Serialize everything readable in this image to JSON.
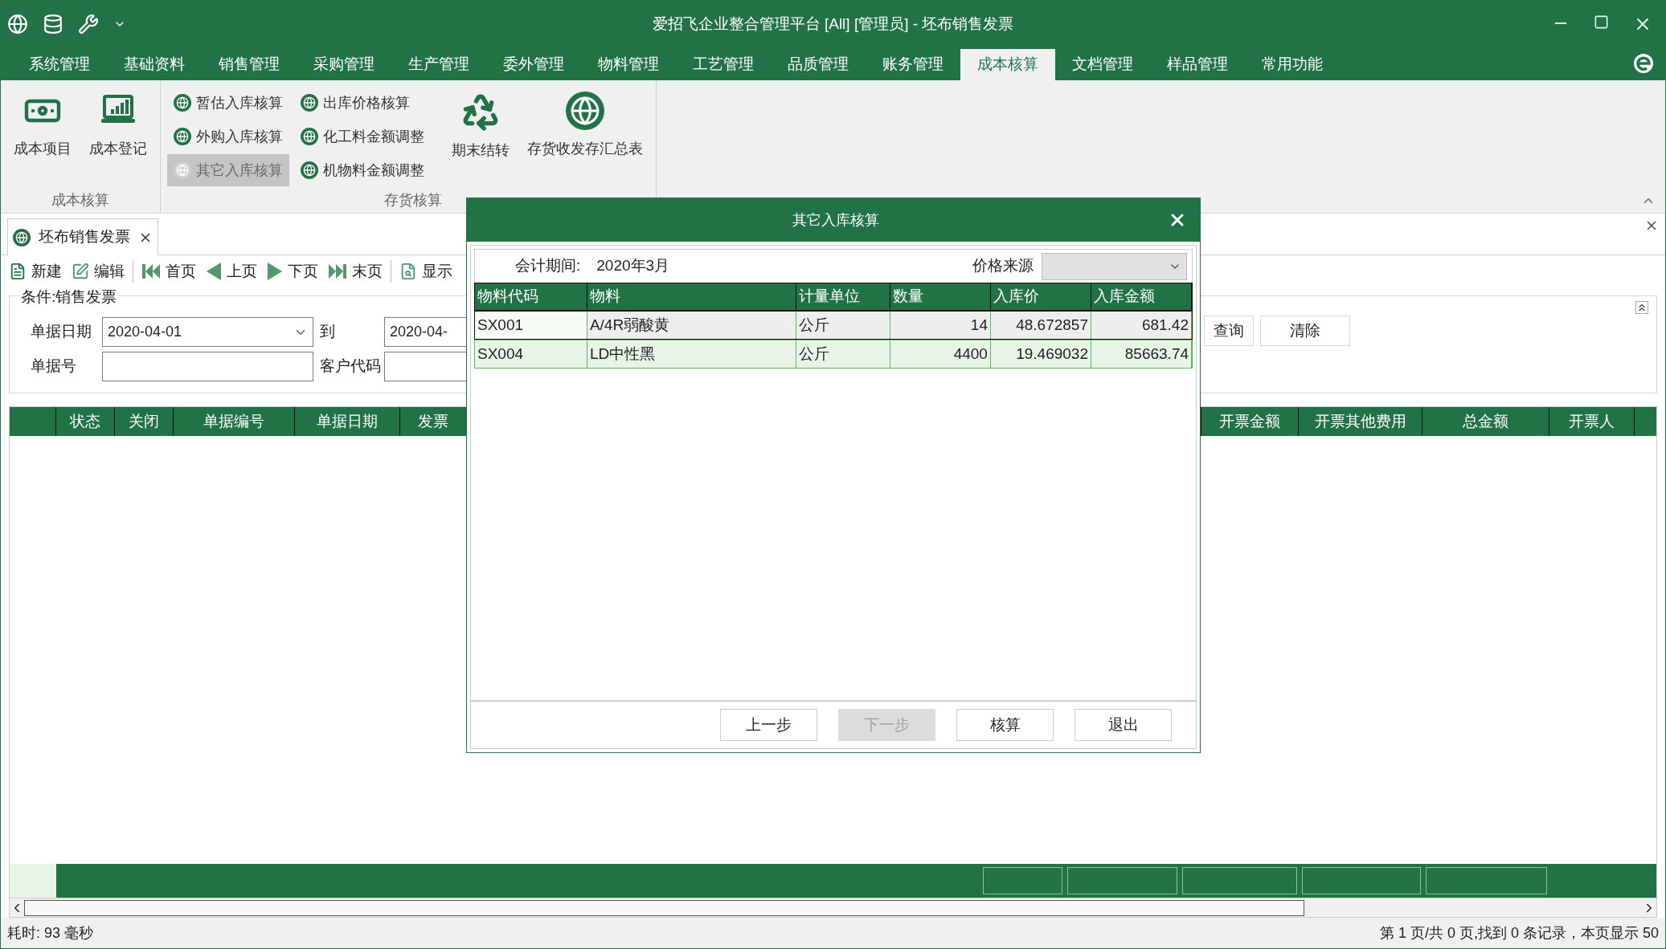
{
  "title_bar": {
    "title": "爱招飞企业整合管理平台 [All] [管理员] - 坯布销售发票"
  },
  "menu_tabs": [
    {
      "label": "系统管理",
      "selected": false
    },
    {
      "label": "基础资料",
      "selected": false
    },
    {
      "label": "销售管理",
      "selected": false
    },
    {
      "label": "采购管理",
      "selected": false
    },
    {
      "label": "生产管理",
      "selected": false
    },
    {
      "label": "委外管理",
      "selected": false
    },
    {
      "label": "物料管理",
      "selected": false
    },
    {
      "label": "工艺管理",
      "selected": false
    },
    {
      "label": "品质管理",
      "selected": false
    },
    {
      "label": "账务管理",
      "selected": false
    },
    {
      "label": "成本核算",
      "selected": true
    },
    {
      "label": "文档管理",
      "selected": false
    },
    {
      "label": "样品管理",
      "selected": false
    },
    {
      "label": "常用功能",
      "selected": false
    }
  ],
  "ribbon": {
    "groups": [
      {
        "label": "成本核算",
        "items": [
          {
            "kind": "large",
            "label": "成本项目",
            "disabled": false
          },
          {
            "kind": "large",
            "label": "成本登记",
            "disabled": false
          }
        ]
      },
      {
        "label": "存货核算",
        "items": [
          {
            "kind": "small",
            "label": "暂估入库核算",
            "disabled": false
          },
          {
            "kind": "small",
            "label": "外购入库核算",
            "disabled": false
          },
          {
            "kind": "small",
            "label": "其它入库核算",
            "disabled": true
          },
          {
            "kind": "small",
            "label": "出库价格核算",
            "disabled": false
          },
          {
            "kind": "small",
            "label": "化工料金额调整",
            "disabled": false
          },
          {
            "kind": "small",
            "label": "机物料金额调整",
            "disabled": false
          },
          {
            "kind": "large",
            "label": "期末结转",
            "disabled": false
          },
          {
            "kind": "large",
            "label": "存货收发存汇总表",
            "disabled": false
          }
        ]
      }
    ]
  },
  "document_tabs": [
    {
      "label": "坯布销售发票",
      "selected": true
    }
  ],
  "toolbar": [
    {
      "label": "新建"
    },
    {
      "label": "编辑"
    },
    {
      "label": "首页"
    },
    {
      "label": "上页"
    },
    {
      "label": "下页"
    },
    {
      "label": "末页"
    },
    {
      "label": "显示"
    }
  ],
  "filter": {
    "title": "条件:销售发票",
    "fields": [
      {
        "label": "单据日期",
        "value": "2020-04-01",
        "kind": "date"
      },
      {
        "label": "到",
        "value": "2020-04-",
        "kind": "date"
      },
      {
        "label": "单据号",
        "kind": "text"
      },
      {
        "label": "客户代码",
        "kind": "text"
      }
    ],
    "buttons": [
      "查询",
      "清除"
    ]
  },
  "grid": {
    "columns_left": [
      "状态",
      "关闭",
      "单据编号",
      "单据日期",
      "发票"
    ],
    "columns_right": [
      "开票金额",
      "开票其他费用",
      "总金额",
      "开票人"
    ]
  },
  "dialog": {
    "title": "其它入库核算",
    "period_label": "会计期间:",
    "period": "2020年3月",
    "price_source_label": "价格来源",
    "columns": [
      "物料代码",
      "物料",
      "计量单位",
      "数量",
      "入库价",
      "入库金额"
    ],
    "rows": [
      {
        "selected": true,
        "cells": [
          "SX001",
          "A/4R弱酸黄",
          "公斤",
          "14",
          "48.672857",
          "681.42"
        ]
      },
      {
        "selected": false,
        "cells": [
          "SX004",
          "LD中性黑",
          "公斤",
          "4400",
          "19.469032",
          "85663.74"
        ]
      }
    ],
    "buttons": [
      {
        "label": "上一步",
        "disabled": false
      },
      {
        "label": "下一步",
        "disabled": true
      },
      {
        "label": "核算",
        "disabled": false
      },
      {
        "label": "退出",
        "disabled": false
      }
    ]
  },
  "status_bar": {
    "elapsed": "耗时: 93 毫秒",
    "paging": "第 1 页/共 0 页,找到 0 条记录，本页显示 50"
  }
}
